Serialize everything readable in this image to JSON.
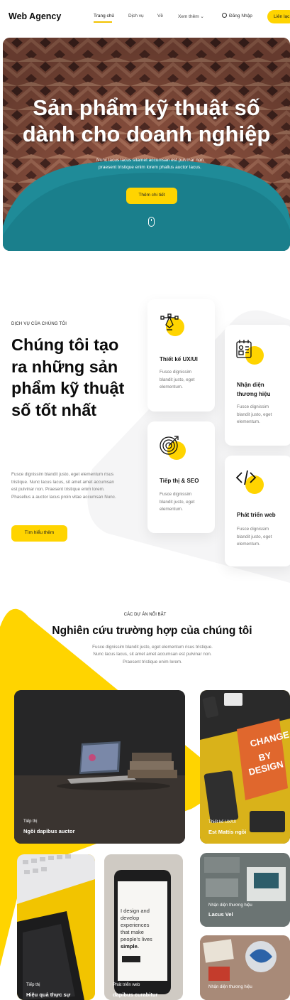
{
  "nav": {
    "brand": "Web Agency",
    "links": [
      "Trang chủ",
      "Dịch vụ",
      "Về",
      "Xem thêm ⌄"
    ],
    "login": "Đăng Nhập",
    "contact": "Liên lạc"
  },
  "hero": {
    "title_line1": "Sản phẩm kỹ thuật số",
    "title_line2": "dành cho doanh nghiệp",
    "subtitle_line1": "Nunc lacus lacus sitamet accumsan est pulvinar non",
    "subtitle_line2": "praesent tristique enim lorem phallus auctor lacus.",
    "button": "Thêm chi tiết"
  },
  "services": {
    "eyebrow": "DỊCH VỤ CỦA CHÚNG TÔI",
    "title": "Chúng tôi tạo ra những sản phẩm kỹ thuật số tốt nhất",
    "description": "Fusce dignissim blandit justo, eget elementum risus tristique. Nunc lacus lacus, sit amet amet accumsan est pulvinar non. Praesent tristique enim lorem. Phasellus a auctor lacus proin vitae accumsan Nunc.",
    "button": "Tìm hiểu thêm",
    "cards": [
      {
        "title": "Thiết kế UX/UI",
        "desc": "Fusce dignissim blandit justo, eget elementum."
      },
      {
        "title": "Nhận diện thương hiệu",
        "desc": "Fusce dignissim blandit justo, eget elementum."
      },
      {
        "title": "Tiếp thị & SEO",
        "desc": "Fusce dignissim blandit justo, eget elementum."
      },
      {
        "title": "Phát triển web",
        "desc": "Fusce dignissim blandit justo, eget elementum."
      }
    ]
  },
  "projects": {
    "eyebrow": "CÁC DỰ ÁN NỔI BẬT",
    "title": "Nghiên cứu trường hợp của chúng tôi",
    "desc_line1": "Fusce dignissim blandit justo, eget elementum risus tristique.",
    "desc_line2": "Nunc lacus lacus, sit amet amet accumsan est pulvinar non.",
    "desc_line3": "Praesent tristique enim lorem.",
    "tiles": [
      {
        "category": "Tiếp thị",
        "name": "Ngồi dapibus auctor"
      },
      {
        "category": "Thiết kế UX/UI",
        "name": "Est Mattis ngồi"
      },
      {
        "category": "Nhận diện thương hiệu",
        "name": "Lacus Vel"
      },
      {
        "category": "Tiếp thị",
        "name": "Hiệu quả thực sự"
      },
      {
        "category": "Phát triển web",
        "name": "dapibus curabitur"
      },
      {
        "category": "Nhận diện thương hiệu",
        "name": ""
      }
    ],
    "phone_text_line1": "I design and",
    "phone_text_line2": "develop",
    "phone_text_line3": "experiences",
    "phone_text_line4": "that make",
    "phone_text_line5": "people's lives",
    "phone_text_line6": "simple.",
    "book_cover_line1": "CHANGE",
    "book_cover_line2": "BY",
    "book_cover_line3": "DESIGN"
  },
  "colors": {
    "accent": "#ffd400",
    "text": "#0b0b0b",
    "muted": "#777777"
  },
  "icons": [
    "pen-tool-icon",
    "id-card-icon",
    "target-icon",
    "code-icon",
    "mouse-icon",
    "user-icon",
    "chevron-down-icon"
  ]
}
